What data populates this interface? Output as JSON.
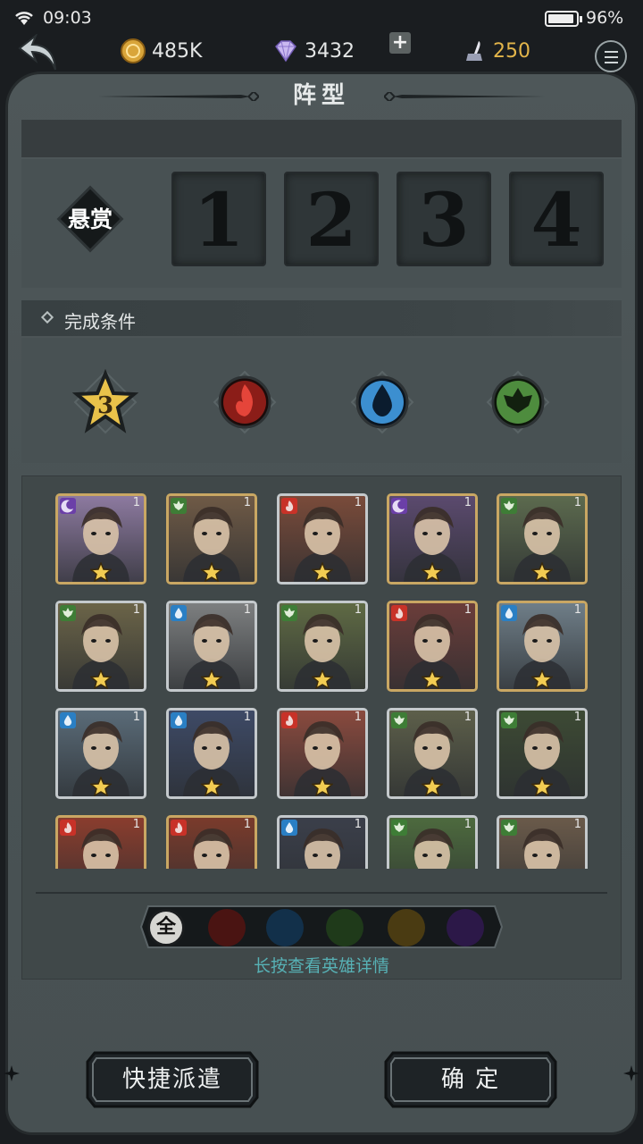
{
  "status_bar": {
    "time": "09:03",
    "battery": "96%"
  },
  "resources": {
    "gold": "485K",
    "gems": "3432",
    "ink": "250",
    "plus": "+"
  },
  "title": "阵型",
  "bounty": {
    "label": "悬赏",
    "slots": [
      "1",
      "2",
      "3",
      "4"
    ]
  },
  "conditions": {
    "header": "完成条件",
    "items": [
      {
        "type": "star",
        "value": "3"
      },
      {
        "type": "fire-element"
      },
      {
        "type": "water-element"
      },
      {
        "type": "nature-element"
      }
    ]
  },
  "heroes": [
    {
      "element": "dark",
      "level": "1",
      "frame": "gold",
      "bg": "#8d7aa0"
    },
    {
      "element": "nature",
      "level": "1",
      "frame": "gold",
      "bg": "#6f5a46"
    },
    {
      "element": "fire",
      "level": "1",
      "frame": "silver",
      "bg": "#7a4b3a"
    },
    {
      "element": "dark",
      "level": "1",
      "frame": "gold",
      "bg": "#5b4a6e"
    },
    {
      "element": "nature",
      "level": "1",
      "frame": "gold",
      "bg": "#5c6a4e"
    },
    {
      "element": "nature",
      "level": "1",
      "frame": "silver",
      "bg": "#6b6448"
    },
    {
      "element": "water",
      "level": "1",
      "frame": "silver",
      "bg": "#7d7f80"
    },
    {
      "element": "nature",
      "level": "1",
      "frame": "silver",
      "bg": "#5f6a44"
    },
    {
      "element": "fire",
      "level": "1",
      "frame": "gold",
      "bg": "#6b3d3a"
    },
    {
      "element": "water",
      "level": "1",
      "frame": "gold",
      "bg": "#6f7e88"
    },
    {
      "element": "water",
      "level": "1",
      "frame": "silver",
      "bg": "#5a6b78"
    },
    {
      "element": "water",
      "level": "1",
      "frame": "silver",
      "bg": "#3e4a66"
    },
    {
      "element": "fire",
      "level": "1",
      "frame": "silver",
      "bg": "#8a4a3e"
    },
    {
      "element": "nature",
      "level": "1",
      "frame": "silver",
      "bg": "#5d5f4a"
    },
    {
      "element": "nature",
      "level": "1",
      "frame": "silver",
      "bg": "#3d4a34"
    },
    {
      "element": "fire",
      "level": "1",
      "frame": "gold",
      "bg": "#8a3d2e"
    },
    {
      "element": "fire",
      "level": "1",
      "frame": "gold",
      "bg": "#7a3b2c"
    },
    {
      "element": "water",
      "level": "1",
      "frame": "silver",
      "bg": "#3b3f4a"
    },
    {
      "element": "nature",
      "level": "1",
      "frame": "silver",
      "bg": "#4d6a3e"
    },
    {
      "element": "nature",
      "level": "1",
      "frame": "silver",
      "bg": "#6a5a4a"
    }
  ],
  "filters": [
    "全",
    "fire",
    "water",
    "nature",
    "light",
    "dark"
  ],
  "hint": "长按查看英雄详情",
  "buttons": {
    "quick_dispatch": "快捷派遣",
    "confirm": "确 定"
  },
  "colors": {
    "fire": "#c83228",
    "water": "#2a7fc4",
    "nature": "#3e7d36",
    "dark": "#6b3fa8",
    "light": "#c99a2e",
    "hint": "#57b1b5",
    "ink": "#e3b54a"
  }
}
